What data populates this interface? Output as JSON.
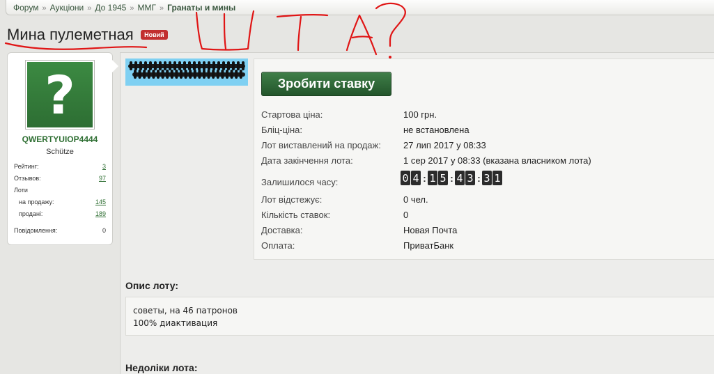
{
  "breadcrumb": {
    "items": [
      "Форум",
      "Аукціони",
      "До 1945",
      "ММГ"
    ],
    "current": "Гранаты и мины",
    "separator": "»"
  },
  "title": "Мина пулеметная",
  "badge": "Новий",
  "annotation_text": "ШТА?",
  "user": {
    "username": "QWERTYUIOP4444",
    "rank": "Schütze",
    "avatar_glyph": "?",
    "stats": {
      "rating_label": "Рейтинг:",
      "rating_value": "3",
      "reviews_label": "Отзывов:",
      "reviews_value": "97",
      "lots_label": "Лоти",
      "for_sale_label": "на продажу:",
      "for_sale_value": "145",
      "sold_label": "продані:",
      "sold_value": "189",
      "messages_label": "Повідомлення:",
      "messages_value": "0"
    }
  },
  "lot": {
    "bid_button": "Зробити ставку",
    "start_price_label": "Стартова ціна:",
    "start_price_value": "100 грн.",
    "blitz_label": "Бліц-ціна:",
    "blitz_value": "не встановлена",
    "listed_label": "Лот виставлений на продаж:",
    "listed_value": "27 лип 2017 у 08:33",
    "end_label": "Дата закінчення лота:",
    "end_value": "1 сер 2017 у 08:33 (вказана власником лота)",
    "remaining_label": "Залишилося часу:",
    "timer_digits": [
      "0",
      "4",
      "1",
      "5",
      "4",
      "3",
      "3",
      "1"
    ],
    "watchers_label": "Лот відстежує:",
    "watchers_value": "0 чел.",
    "bids_label": "Кількість ставок:",
    "bids_value": "0",
    "delivery_label": "Доставка:",
    "delivery_value": "Новая Почта",
    "payment_label": "Оплата:",
    "payment_value": "ПриватБанк"
  },
  "description": {
    "title": "Опис лоту:",
    "line1": "советы, на 46 патронов",
    "line2": "100% диактивация"
  },
  "defects": {
    "title": "Недоліки лота:"
  },
  "colors": {
    "accent_green": "#2f6f33",
    "badge_red": "#c22f2f",
    "scribble_red": "#e01515",
    "thumb_bg": "#7fd0f2"
  }
}
